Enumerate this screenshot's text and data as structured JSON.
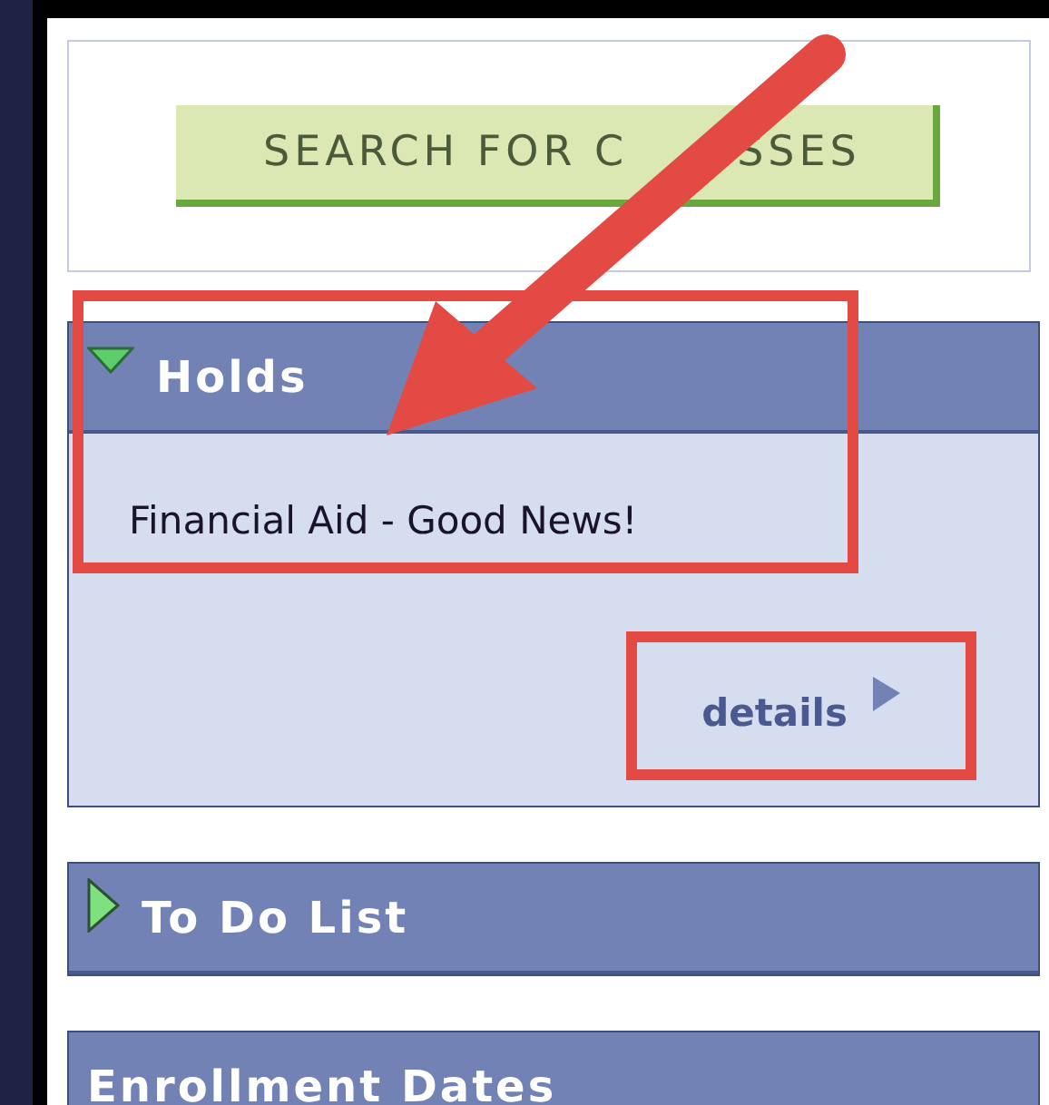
{
  "search_button": {
    "label_parts": [
      "SEARCH FOR C",
      "SSES"
    ]
  },
  "sections": [
    {
      "title": "Holds",
      "kind": "collapsible",
      "expanded": true,
      "highlighted": true,
      "items": [
        "Financial Aid - Good News!"
      ],
      "link": "details",
      "link_highlighted": true
    },
    {
      "title": "To Do List",
      "kind": "collapsible",
      "expanded": false,
      "highlighted": false
    },
    {
      "title": "Enrollment Dates",
      "kind": "plain",
      "highlighted": false
    }
  ],
  "annotations": [
    {
      "kind": "arrow"
    }
  ]
}
